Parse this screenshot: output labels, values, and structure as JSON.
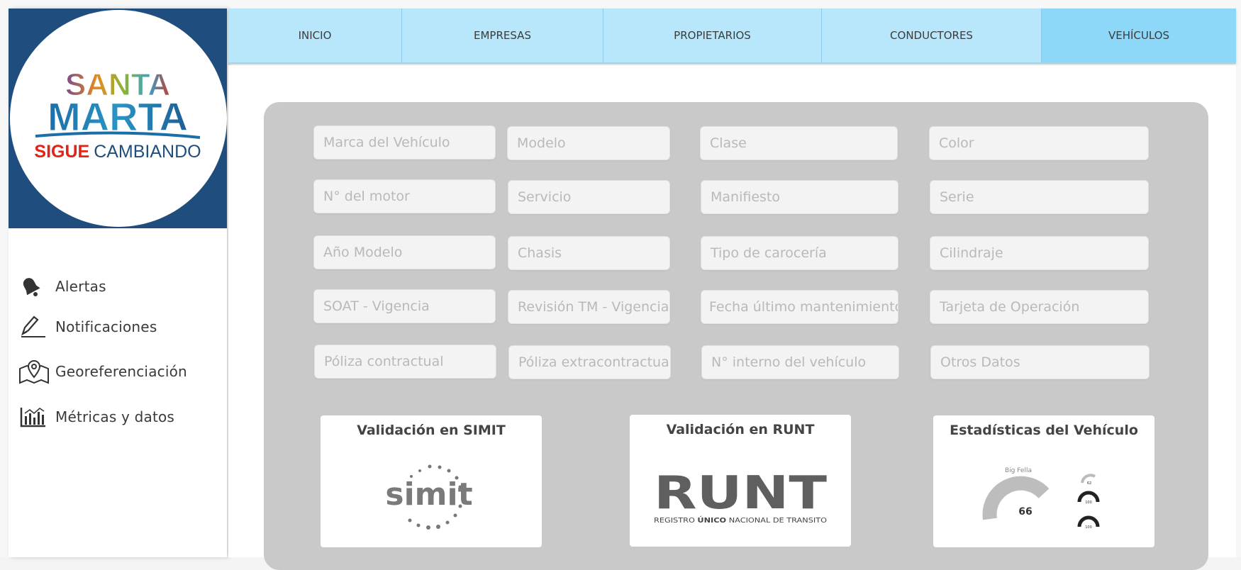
{
  "logo": {
    "line1": "SANTA",
    "line2": "MARTA",
    "tagline_bold": "SIGUE",
    "tagline_rest": "CAMBIANDO"
  },
  "sidebar": {
    "items": [
      {
        "label": "Alertas",
        "icon": "bell-icon"
      },
      {
        "label": "Notificaciones",
        "icon": "pencil-icon"
      },
      {
        "label": "Georeferenciación",
        "icon": "map-pin-icon"
      },
      {
        "label": "Métricas y datos",
        "icon": "bar-chart-icon"
      }
    ]
  },
  "nav": {
    "tabs": [
      {
        "label": "INICIO"
      },
      {
        "label": "EMPRESAS"
      },
      {
        "label": "PROPIETARIOS"
      },
      {
        "label": "CONDUCTORES"
      },
      {
        "label": "VEHÍCULOS",
        "active": true
      }
    ]
  },
  "form": {
    "fields": [
      "Marca del Vehículo",
      "Modelo",
      "Clase",
      "Color",
      "N° del motor",
      "Servicio",
      "Manifiesto",
      "Serie",
      "Año Modelo",
      "Chasis",
      "Tipo de carocería",
      "Cilindraje",
      "SOAT - Vigencia",
      "Revisión TM - Vigencia",
      "Fecha último mantenimiento",
      "Tarjeta de Operación",
      "Póliza contractual",
      "Póliza extracontractual",
      "N° interno del vehículo",
      "Otros Datos"
    ]
  },
  "cards": {
    "simit": {
      "title": "Validación en SIMIT",
      "logo_text": "simit"
    },
    "runt": {
      "title": "Validación en RUNT",
      "logo_text": "RUNT",
      "logo_sub_pre": "REGISTRO ",
      "logo_sub_bold": "ÚNICO",
      "logo_sub_post": " NACIONAL DE TRANSITO"
    },
    "stats": {
      "title": "Estadísticas del Vehículo",
      "gauge_label": "Big Fella",
      "gauge_value": "66",
      "mini_values": [
        "62",
        "100",
        "100"
      ]
    }
  },
  "colors": {
    "logo_bg": "#1f4e7e",
    "nav_bg": "#b8e6fb",
    "nav_active": "#8dd7f8",
    "panel_bg": "#c9c9c9"
  }
}
